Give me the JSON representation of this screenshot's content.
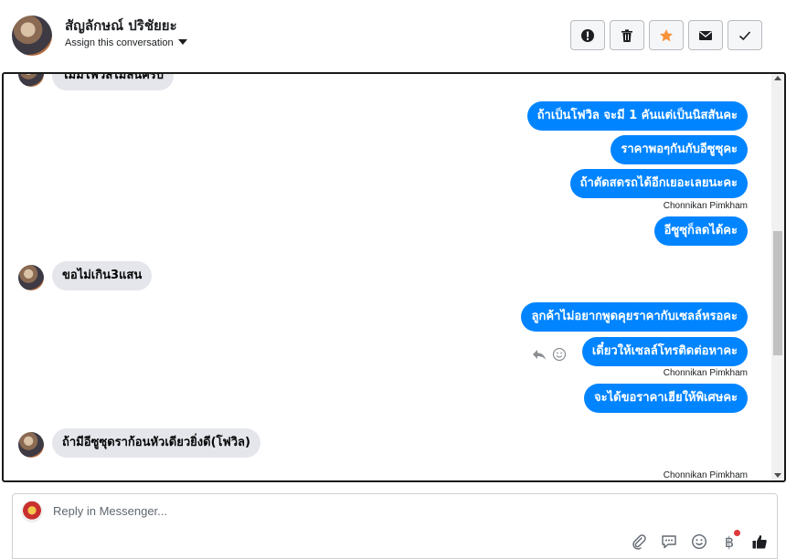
{
  "header": {
    "contact_name": "สัญลักษณ์ ปริชัยยะ",
    "assign_label": "Assign this conversation"
  },
  "actions": [
    {
      "name": "mark-spam-button",
      "icon": "exclamation-icon"
    },
    {
      "name": "delete-button",
      "icon": "trash-icon"
    },
    {
      "name": "star-button",
      "icon": "star-icon"
    },
    {
      "name": "mark-unread-button",
      "icon": "envelope-icon"
    },
    {
      "name": "mark-done-button",
      "icon": "check-icon"
    }
  ],
  "colors": {
    "outgoing_bubble": "#0084ff",
    "incoming_bubble": "#e4e6eb",
    "star": "#f7923b"
  },
  "messages": {
    "m0": "ไม่มีโฟวิลไม่ลนครับ",
    "m1": "ถ้าเป็นโฟวิล จะมี 1 คันแต่เป็นนิสสันคะ",
    "m2": "ราคาพอๆกันกับอีซูซุคะ",
    "m3": "ถ้าตัดสดรถได้อีกเยอะเลยนะคะ",
    "s1": "Chonnikan Pimkham",
    "m4": "อีซูซุก็ลดได้คะ",
    "m5": "ขอไม่เกิน3แสน",
    "m6": "ลูกค้าไม่อยากพูดคุยราคากับเซลล์หรอคะ",
    "m7": "เดี๋ยวให้เซลล์โทรติดต่อหาคะ",
    "s2": "Chonnikan Pimkham",
    "m8": "จะได้ขอราคาเฮียให้พิเศษคะ",
    "m9": "ถ้ามีอีซูซุดราก้อนหัวเดียวยิ่งดี(โฟวิล)",
    "s3": "Chonnikan Pimkham"
  },
  "composer": {
    "placeholder": "Reply in Messenger...",
    "tools": [
      "paperclip-icon",
      "chat-bubble-icon",
      "smiley-icon",
      "baht-icon",
      "thumbs-up-icon"
    ],
    "currency_symbol": "฿"
  }
}
